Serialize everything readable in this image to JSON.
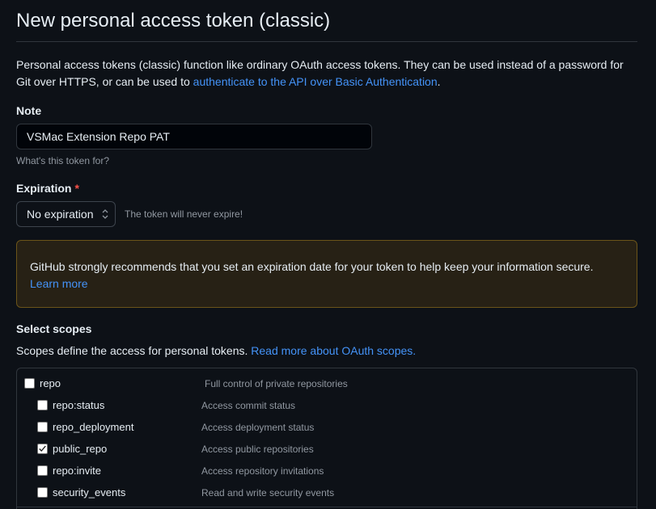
{
  "page": {
    "title": "New personal access token (classic)",
    "intro_text": "Personal access tokens (classic) function like ordinary OAuth access tokens. They can be used instead of a password for Git over HTTPS, or can be used to ",
    "intro_link": "authenticate to the API over Basic Authentication",
    "intro_end": "."
  },
  "note": {
    "label": "Note",
    "value": "VSMac Extension Repo PAT",
    "hint": "What's this token for?"
  },
  "expiration": {
    "label": "Expiration",
    "required_mark": "*",
    "selected": "No expiration",
    "message": "The token will never expire!"
  },
  "warning": {
    "text": "GitHub strongly recommends that you set an expiration date for your token to help keep your information secure.",
    "link": "Learn more"
  },
  "scopes": {
    "label": "Select scopes",
    "description": "Scopes define the access for personal tokens. ",
    "description_link": "Read more about OAuth scopes.",
    "items": [
      {
        "name": "repo",
        "help": "Full control of private repositories",
        "checked": false,
        "parent": true
      },
      {
        "name": "repo:status",
        "help": "Access commit status",
        "checked": false,
        "parent": false
      },
      {
        "name": "repo_deployment",
        "help": "Access deployment status",
        "checked": false,
        "parent": false
      },
      {
        "name": "public_repo",
        "help": "Access public repositories",
        "checked": true,
        "parent": false
      },
      {
        "name": "repo:invite",
        "help": "Access repository invitations",
        "checked": false,
        "parent": false
      },
      {
        "name": "security_events",
        "help": "Read and write security events",
        "checked": false,
        "parent": false
      }
    ]
  },
  "colors": {
    "background": "#0d1117",
    "link": "#4493f8",
    "warning_bg": "#272115",
    "warning_border": "#6b5419",
    "required": "#f85149"
  }
}
